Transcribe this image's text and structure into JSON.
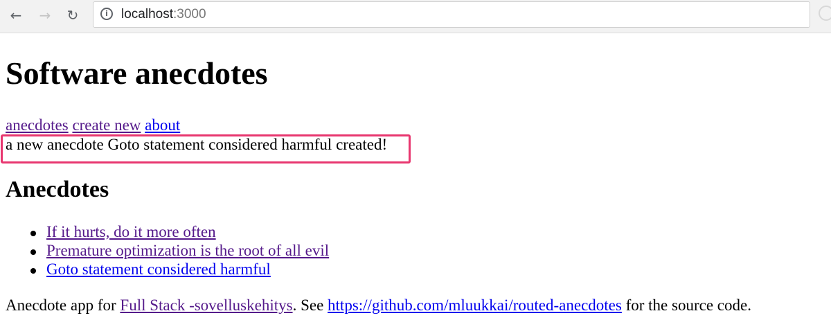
{
  "browser": {
    "address_host": "localhost",
    "address_port": ":3000",
    "back_icon": "arrow-left-icon",
    "forward_icon": "arrow-right-icon",
    "reload_icon": "reload-icon",
    "info_icon": "info-icon"
  },
  "page": {
    "title": "Software anecdotes",
    "menu": [
      {
        "label": "anecdotes",
        "visited": true
      },
      {
        "label": "create new",
        "visited": true
      },
      {
        "label": "about",
        "visited": false
      }
    ],
    "notification": "a new anecdote Goto statement considered harmful created!",
    "highlight_color": "#e8366f",
    "anecdotes_heading": "Anecdotes",
    "anecdotes": [
      {
        "label": "If it hurts, do it more often",
        "visited": true
      },
      {
        "label": "Premature optimization is the root of all evil",
        "visited": true
      },
      {
        "label": "Goto statement considered harmful",
        "visited": false
      }
    ],
    "footer": {
      "prefix": "Anecdote app for ",
      "course_link": "Full Stack -sovelluskehitys",
      "middle": ". See ",
      "repo_link": "https://github.com/mluukkai/routed-anecdotes",
      "suffix": " for the source code."
    }
  },
  "colors": {
    "link": "#0000ee",
    "visited_link": "#551a8b"
  }
}
